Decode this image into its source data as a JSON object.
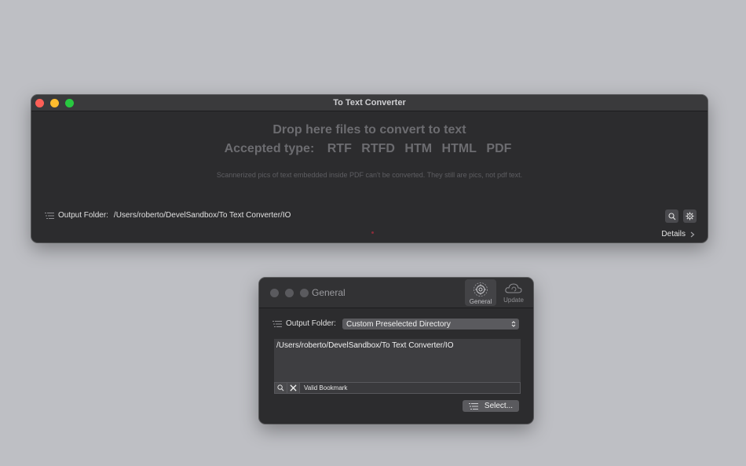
{
  "main_window": {
    "title": "To Text Converter",
    "drop_title": "Drop here files to convert to text",
    "accepted_label": "Accepted type:",
    "types": [
      "RTF",
      "RTFD",
      "HTM",
      "HTML",
      "PDF"
    ],
    "note": "Scannerized pics of text embedded inside PDF can't be converted. They still are pics, not pdf text.",
    "output_label": "Output Folder:",
    "output_path": "/Users/roberto/DevelSandbox/To Text Converter/IO",
    "details_label": "Details",
    "icons": [
      "list-icon",
      "search-icon",
      "gear-icon",
      "chevron-right-icon"
    ]
  },
  "pref_window": {
    "title": "General",
    "tabs": [
      {
        "label": "General",
        "icon": "gear-icon",
        "selected": true
      },
      {
        "label": "Update",
        "icon": "cloud-icon",
        "selected": false
      }
    ],
    "output_label": "Output Folder:",
    "popup_value": "Custom Preselected Directory",
    "path_text": "/Users/roberto/DevelSandbox/To Text Converter/IO",
    "status_text": "Valid Bookmark",
    "select_label": "Select...",
    "icons": [
      "list-icon",
      "search-icon",
      "close-icon",
      "chevron-updown-icon"
    ]
  },
  "colors": {
    "background": "#bebfc4",
    "window": "#2c2c2e",
    "close": "#fe5f57",
    "minimize": "#febc2e",
    "zoom": "#28c840"
  }
}
